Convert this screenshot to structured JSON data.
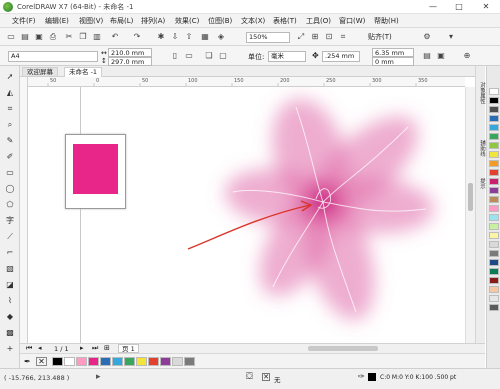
{
  "window": {
    "title": "CorelDRAW X7 (64-Bit) - 未命名 -1",
    "minimize_glyph": "—",
    "maximize_glyph": "□",
    "close_glyph": "✕"
  },
  "menus": [
    "文件(F)",
    "编辑(E)",
    "视图(V)",
    "布局(L)",
    "排列(A)",
    "效果(C)",
    "位图(B)",
    "文本(X)",
    "表格(T)",
    "工具(O)",
    "窗口(W)",
    "帮助(H)"
  ],
  "toolbar": {
    "zoom": "150%",
    "snap_label": "贴齐(T)"
  },
  "property_bar": {
    "page_size": "A4",
    "width": "210.0 mm",
    "height": "297.0 mm",
    "units_label": "单位:",
    "units_value": "毫米",
    "nudge": ".254 mm",
    "dup_x": "6.35 mm",
    "dup_y": "0 mm"
  },
  "tabs": [
    {
      "label": "欢迎屏幕",
      "active": false
    },
    {
      "label": "未命名 -1",
      "active": true
    }
  ],
  "ruler": {
    "labels": [
      "50",
      "0",
      "50",
      "100",
      "150",
      "200",
      "250",
      "300",
      "350"
    ]
  },
  "dockers": [
    "对象属性",
    "辅助线",
    "提示"
  ],
  "page_nav": {
    "page_count": "1 / 1",
    "page_tab": "页 1"
  },
  "status": {
    "coords": "( -15.766, 213.488 )",
    "fill_label": "无",
    "color_info": "C:0 M:0 Y:0 K:100 .500 pt"
  },
  "colors": {
    "accent_pink": "#e8268a",
    "flower": "#e06aa8",
    "arrow": "#d9362a"
  },
  "palette": [
    "#ffffff",
    "#000000",
    "#4f4f4f",
    "#2a6db5",
    "#35a7dc",
    "#3aa55c",
    "#8fc740",
    "#f2e43b",
    "#f39c25",
    "#e2412f",
    "#c9216d",
    "#8d3c98",
    "#b98c5a",
    "#ff9bc2",
    "#9be3f0",
    "#c9f0a0",
    "#fbf3a6",
    "#d9d9d9",
    "#7a7a7a",
    "#1d4a87",
    "#0d7b55",
    "#8a1b1b",
    "#f5c7a2",
    "#e6e6e6",
    "#5a5a5a"
  ],
  "hpalette": [
    "#000000",
    "#ffffff",
    "#ff9bc2",
    "#e8268a",
    "#2a6db5",
    "#35a7dc",
    "#3aa55c",
    "#f2e43b",
    "#e2412f",
    "#8d3c98",
    "#d9d9d9",
    "#7a7a7a"
  ]
}
